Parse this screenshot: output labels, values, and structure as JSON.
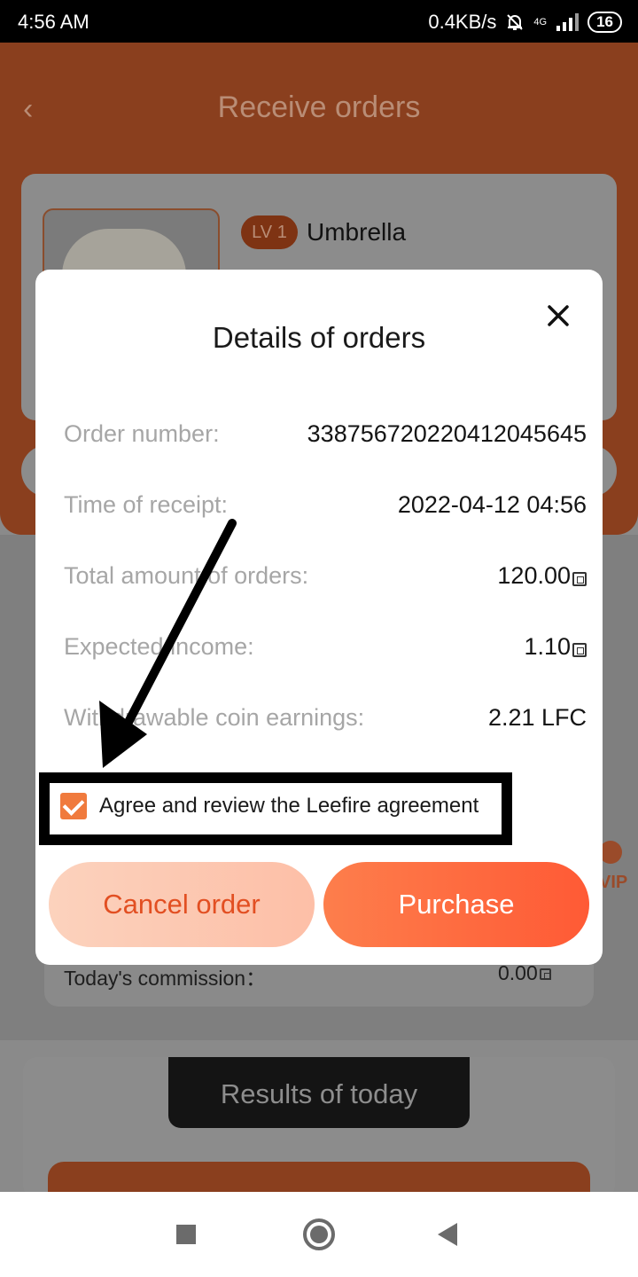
{
  "status_bar": {
    "time": "4:56 AM",
    "net_speed": "0.4KB/s",
    "network": "4G",
    "battery": "16"
  },
  "background": {
    "title": "Receive orders",
    "product": {
      "level": "LV 1",
      "name": "Umbrella"
    },
    "vip_badge": "VIP",
    "commission": {
      "label": "Today's commission：",
      "value": "0.00"
    },
    "results_button": "Results of today"
  },
  "modal": {
    "title": "Details of orders",
    "rows": [
      {
        "label": "Order number:",
        "value": "3387567202204120456​45"
      },
      {
        "label": "Time of receipt:",
        "value": "2022-04-12 04:56"
      },
      {
        "label": "Total amount of orders:",
        "value": "120.00"
      },
      {
        "label": "Expected income:",
        "value": "1.10"
      },
      {
        "label": "Withdrawable coin earnings:",
        "value": "2.21 LFC"
      }
    ],
    "agreement": {
      "checked": true,
      "label": "Agree and review the Leefire agreement"
    },
    "cancel_label": "Cancel order",
    "purchase_label": "Purchase"
  },
  "colors": {
    "accent": "#ff6a3d",
    "cancel_bg": "#fdc9b3",
    "cancel_text": "#e24f22"
  }
}
